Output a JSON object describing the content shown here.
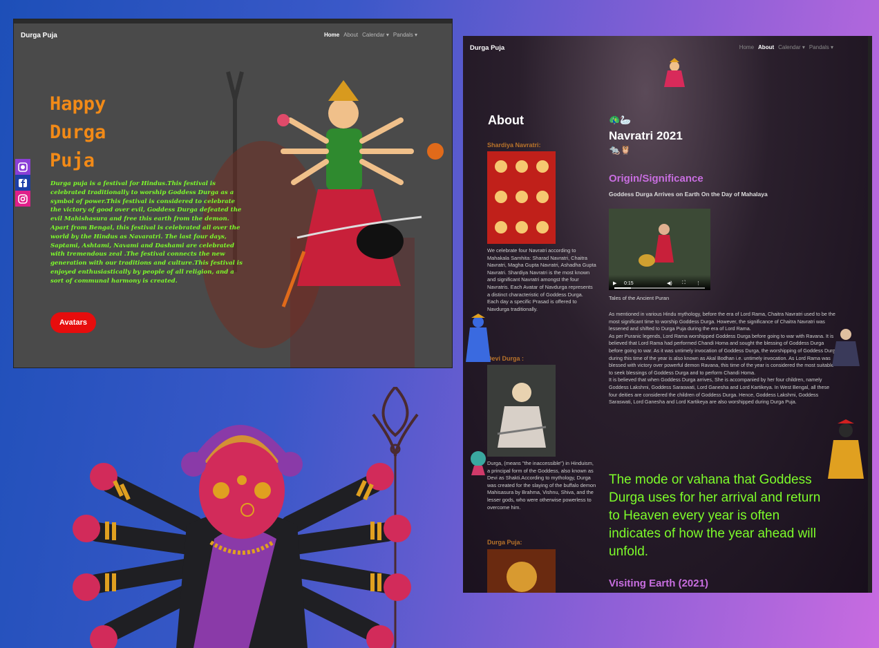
{
  "left_page": {
    "brand": "Durga Puja",
    "nav": [
      "Home",
      "About",
      "Calendar ▾",
      "Pandals ▾"
    ],
    "hero_title": [
      "Happy",
      "Durga",
      "Puja"
    ],
    "hero_paragraph_1": "Durga puja is a festival for Hindus.This festival is celebrated traditionally to worship Goddess Durga as a symbol of power.This festival is considered to celebrate the victory of good over evil, Goddess Durga defeated the evil Mahishasura and free this earth from the demon.",
    "hero_paragraph_2": "Apart from Bengal, this festival is celebrated all over the world by the Hindus as Navaratri. The last four days, Saptami, Ashtami, Navami and Dashami are celebrated with tremendous zeal .The festival connects the new generation with our traditions and culture.This festival is enjoyed enthusiastically by people of all religion, and a sort of communal harmony is created.",
    "button_label": "Avatars",
    "social_icons": [
      "github-icon",
      "facebook-icon",
      "instagram-icon"
    ]
  },
  "right_page": {
    "brand": "Durga Puja",
    "nav": [
      "Home",
      "About",
      "Calendar ▾",
      "Pandals ▾"
    ],
    "about_heading": "About",
    "shardiya_heading": "Shardiya Navratri:",
    "shardiya_text_1": "We celebrate four Navratri according to Mahakala Samhita: Sharad Navratri, Chaitra Navratri, Magha Gupta Navratri, Ashadha Gupta Navratri. Shardiya Navratri is the most known and significant Navratri amongst the four Navratris. Each Avatar of Navdurga represents a distinct characteristic of Goddess Durga.",
    "shardiya_text_2": "Each day a specific Prasad is offered to Navdurga traditionally.",
    "devi_heading": "Devi Durga :",
    "devi_text": "Durga, (means \"the inaccessible\") in Hinduism, a principal form of the Goddess, also known as Devi as Shakti.According to mythology, Durga was created for the slaying of the buffalo demon Mahisasura by Brahma, Vishnu, Shiva, and the lesser gods, who were otherwise powerless to overcome him.",
    "puja_heading": "Durga Puja:",
    "main_title": "Navratri 2021",
    "origin_heading": "Origin/Significance",
    "arrives_text": "Goddess Durga Arrives on Earth On the Day of Mahalaya",
    "video_time": "0:15",
    "video_caption": "Tales of the Ancient Puran",
    "body_1": "As mentioned in various Hindu mythology, before the era of Lord Rama, Chaitra Navratri used to be the most significant time to worship Goddess Durga. However, the significance of Chaitra Navratri was lessened and shifted to Durga Puja during the era of Lord Rama.",
    "body_2": "As per Puranic legends, Lord Rama worshipped Goddess Durga before going to war with Ravana. It is believed that Lord Rama had performed Chandi Homa and sought the blessing of Goddess Durga before going to war. As it was untimely invocation of Goddess Durga, the worshipping of Goddess Durga during this time of the year is also known as Akal Bodhan i.e. untimely invocation. As Lord Rama was blessed with victory over powerful demon Ravana, this time of the year is considered the most suitable to seek blessings of Goddess Durga and to perform Chandi Homa.",
    "body_3": "It is believed that when Goddess Durga arrives, She is accompanied by her four children, namely Goddess Lakshmi, Goddess Saraswati, Lord Ganesha and Lord Kartikeya. In West Bengal, all these four deities are considered the children of Goddess Durga. Hence, Goddess Lakshmi, Goddess Saraswati, Lord Ganesha and Lord Kartikeya are also worshipped during Durga Puja.",
    "vahana_text": "The mode or vahana that Goddess Durga uses for her arrival and return to Heaven every year is often indicates of how the year ahead will unfold.",
    "visiting_heading": "Visiting Earth (2021)"
  },
  "colors": {
    "accent_orange": "#f28a17",
    "accent_green": "#7dfc2a",
    "accent_purple": "#c86ee0",
    "button_red": "#e70d0d"
  }
}
